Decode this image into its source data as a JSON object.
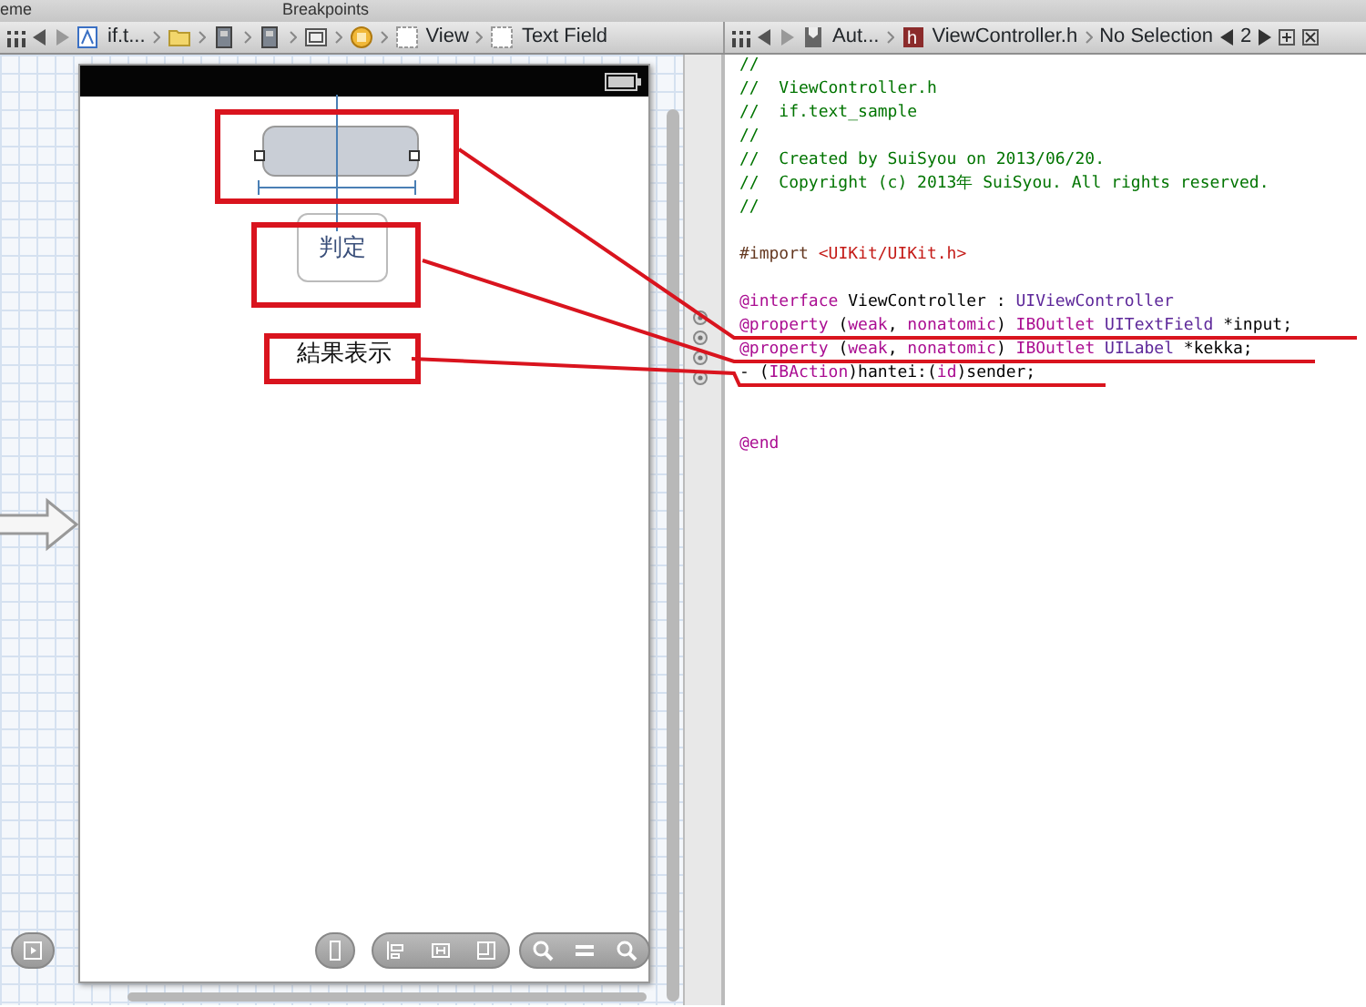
{
  "top_strip": {
    "labels": [
      "eme",
      "Breakpoints"
    ]
  },
  "left_jump_bar": {
    "items": [
      {
        "kind": "project",
        "label": "if.t..."
      },
      {
        "kind": "folder"
      },
      {
        "kind": "file"
      },
      {
        "kind": "file"
      },
      {
        "kind": "scene"
      },
      {
        "kind": "controller"
      },
      {
        "kind": "view",
        "label": "View"
      },
      {
        "kind": "view",
        "label": "Text Field"
      }
    ]
  },
  "right_jump_bar": {
    "items": [
      {
        "kind": "mode",
        "label": "Aut..."
      },
      {
        "kind": "header",
        "icon_text": "h",
        "label": "ViewController.h"
      },
      {
        "kind": "plain",
        "label": "No Selection"
      }
    ],
    "counter": "2"
  },
  "storyboard": {
    "button_label": "判定",
    "result_label": "結果表示"
  },
  "code_lines": [
    {
      "kind": "code",
      "tokens": [
        {
          "kind": "comment",
          "text": "//"
        }
      ]
    },
    {
      "kind": "code",
      "tokens": [
        {
          "kind": "comment",
          "text": "//  ViewController.h"
        }
      ]
    },
    {
      "kind": "code",
      "tokens": [
        {
          "kind": "comment",
          "text": "//  if.text_sample"
        }
      ]
    },
    {
      "kind": "code",
      "tokens": [
        {
          "kind": "comment",
          "text": "//"
        }
      ]
    },
    {
      "kind": "code",
      "tokens": [
        {
          "kind": "comment",
          "text": "//  Created by SuiSyou on 2013/06/20."
        }
      ]
    },
    {
      "kind": "code",
      "tokens": [
        {
          "kind": "comment",
          "text": "//  Copyright (c) 2013年 SuiSyou. All rights reserved."
        }
      ]
    },
    {
      "kind": "code",
      "tokens": [
        {
          "kind": "comment",
          "text": "//"
        }
      ]
    },
    {
      "kind": "blank"
    },
    {
      "kind": "code",
      "tokens": [
        {
          "kind": "directive",
          "text": "#import "
        },
        {
          "kind": "string",
          "text": "<UIKit/UIKit.h>"
        }
      ]
    },
    {
      "kind": "blank"
    },
    {
      "kind": "code",
      "tokens": [
        {
          "kind": "keyword",
          "text": "@interface"
        },
        {
          "kind": "plain",
          "text": " ViewController : "
        },
        {
          "kind": "type",
          "text": "UIViewController"
        }
      ]
    },
    {
      "kind": "code",
      "tokens": [
        {
          "kind": "keyword",
          "text": "@property"
        },
        {
          "kind": "plain",
          "text": " ("
        },
        {
          "kind": "keyword",
          "text": "weak"
        },
        {
          "kind": "plain",
          "text": ", "
        },
        {
          "kind": "keyword",
          "text": "nonatomic"
        },
        {
          "kind": "plain",
          "text": ") "
        },
        {
          "kind": "keyword",
          "text": "IBOutlet"
        },
        {
          "kind": "type",
          "text": " UITextField"
        },
        {
          "kind": "plain",
          "text": " *input;"
        }
      ]
    },
    {
      "kind": "code",
      "tokens": [
        {
          "kind": "keyword",
          "text": "@property"
        },
        {
          "kind": "plain",
          "text": " ("
        },
        {
          "kind": "keyword",
          "text": "weak"
        },
        {
          "kind": "plain",
          "text": ", "
        },
        {
          "kind": "keyword",
          "text": "nonatomic"
        },
        {
          "kind": "plain",
          "text": ") "
        },
        {
          "kind": "keyword",
          "text": "IBOutlet"
        },
        {
          "kind": "type",
          "text": " UILabel"
        },
        {
          "kind": "plain",
          "text": " *kekka;"
        }
      ]
    },
    {
      "kind": "code",
      "tokens": [
        {
          "kind": "plain",
          "text": "- ("
        },
        {
          "kind": "keyword",
          "text": "IBAction"
        },
        {
          "kind": "plain",
          "text": ")hantei:("
        },
        {
          "kind": "keyword",
          "text": "id"
        },
        {
          "kind": "plain",
          "text": ")sender;"
        }
      ]
    },
    {
      "kind": "blank"
    },
    {
      "kind": "blank"
    },
    {
      "kind": "code",
      "tokens": [
        {
          "kind": "keyword",
          "text": "@end"
        }
      ]
    }
  ]
}
